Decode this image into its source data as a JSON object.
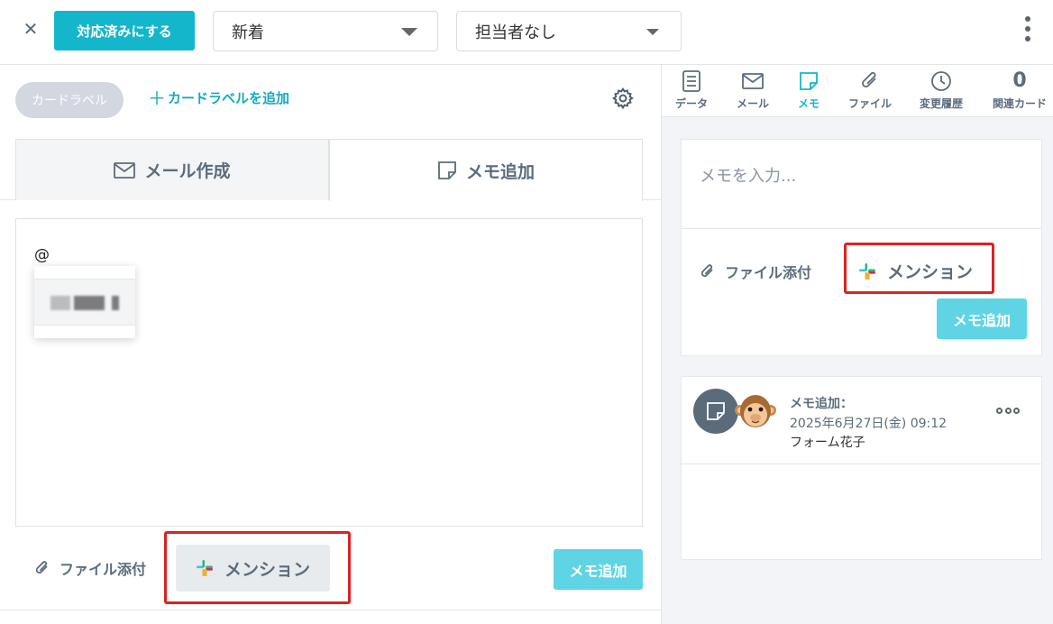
{
  "topbar": {
    "resolve_label": "対応済みにする",
    "status_value": "新着",
    "assignee_value": "担当者なし"
  },
  "left": {
    "card_label": "カードラベル",
    "add_card_label": "カードラベルを追加",
    "tabs": [
      {
        "label": "メール作成"
      },
      {
        "label": "メモ追加"
      }
    ],
    "editor_text": "@",
    "attach_label": "ファイル添付",
    "mention_label": "メンション",
    "memo_add_label": "メモ追加"
  },
  "right": {
    "tabs": [
      {
        "label": "データ",
        "icon": "document-icon"
      },
      {
        "label": "メール",
        "icon": "mail-icon"
      },
      {
        "label": "メモ",
        "icon": "memo-icon"
      },
      {
        "label": "ファイル",
        "icon": "paperclip-icon"
      },
      {
        "label": "変更履歴",
        "icon": "clock-icon"
      },
      {
        "label": "関連カード",
        "count": "0"
      }
    ],
    "memo_placeholder": "メモを入力...",
    "attach_label": "ファイル添付",
    "mention_label": "メンション",
    "memo_add_label": "メモ追加",
    "entry": {
      "title": "メモ追加：",
      "date": "2025年6月27日(金) 09:12",
      "author": "フォーム花子"
    }
  },
  "colors": {
    "accent": "#14b6cc",
    "button_light": "#5fd4e4",
    "highlight_red": "#dd2222"
  }
}
